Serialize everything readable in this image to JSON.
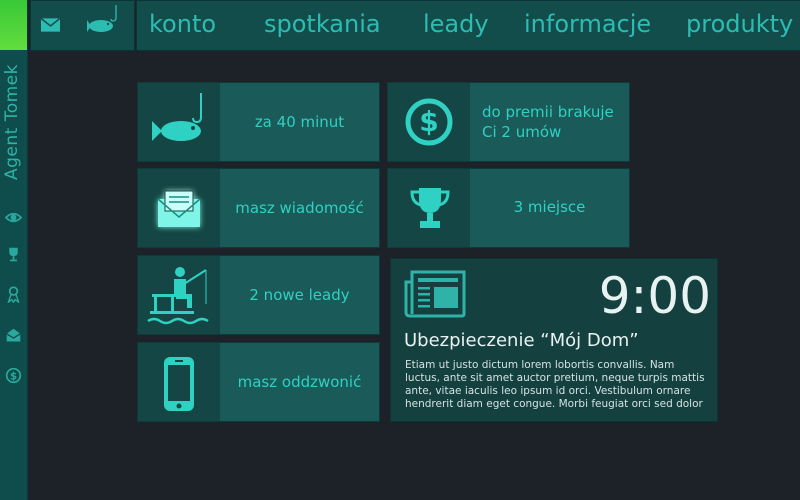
{
  "agent": {
    "name": "Agent Tomek"
  },
  "nav": {
    "items": [
      "konto",
      "spotkania",
      "leady",
      "informacje",
      "produkty"
    ]
  },
  "tiles": {
    "fish": {
      "label": "za 40 minut"
    },
    "money": {
      "line1": "do premii brakuje",
      "line2": "Ci 2 umów"
    },
    "message": {
      "label": "masz wiadomość"
    },
    "trophy": {
      "label": "3 miejsce"
    },
    "leads": {
      "label": "2 nowe leady"
    },
    "phone": {
      "label": "masz oddzwonić"
    }
  },
  "news": {
    "time": "9:00",
    "title": "Ubezpieczenie “Mój Dom”",
    "body": "Etiam ut justo dictum lorem lobortis convallis. Nam luctus, ante sit amet auctor pretium, neque turpis mattis ante, vitae iaculis leo ipsum id orci. Vestibulum ornare hendrerit diam eget congue. Morbi feugiat orci sed dolor"
  },
  "colors": {
    "accent": "#2fd1c2",
    "brand_green": "#4fd83a",
    "tile": "#1a5a58",
    "background": "#1c2228"
  },
  "icons": [
    "envelope-icon",
    "fish-icon",
    "dollar-icon",
    "trophy-icon",
    "fisherman-icon",
    "phone-icon",
    "newspaper-icon",
    "eye-icon",
    "award-icon",
    "inbox-icon"
  ]
}
